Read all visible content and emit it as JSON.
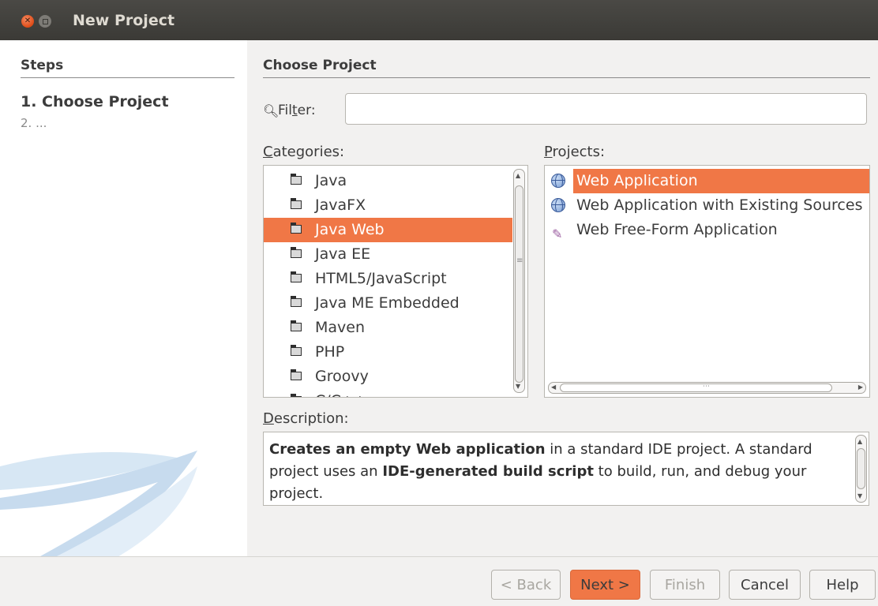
{
  "window": {
    "title": "New Project"
  },
  "steps": {
    "heading": "Steps",
    "items": [
      "1.  Choose Project",
      "2.  ..."
    ]
  },
  "main": {
    "heading": "Choose Project",
    "filter": {
      "label_pre": "Fil",
      "label_mn": "t",
      "label_post": "er:",
      "value": ""
    },
    "categories": {
      "label_mn": "C",
      "label_rest": "ategories:",
      "items": [
        "Java",
        "JavaFX",
        "Java Web",
        "Java EE",
        "HTML5/JavaScript",
        "Java ME Embedded",
        "Maven",
        "PHP",
        "Groovy",
        "C/C++"
      ],
      "selected": "Java Web"
    },
    "projects": {
      "label_mn": "P",
      "label_rest": "rojects:",
      "items": [
        "Web Application",
        "Web Application with Existing Sources",
        "Web Free-Form Application"
      ],
      "selected": "Web Application"
    },
    "description": {
      "label_mn": "D",
      "label_rest": "escription:",
      "bold1": "Creates an empty Web application",
      "text1": " in a standard IDE project. A standard project uses an ",
      "bold2": "IDE-generated build script",
      "text2": " to build, run, and debug your project."
    }
  },
  "buttons": {
    "back": "< Back",
    "next": "Next >",
    "finish": "Finish",
    "cancel": "Cancel",
    "help": "Help"
  },
  "colors": {
    "accent": "#f07746",
    "titlebar": "#3b3a36"
  }
}
